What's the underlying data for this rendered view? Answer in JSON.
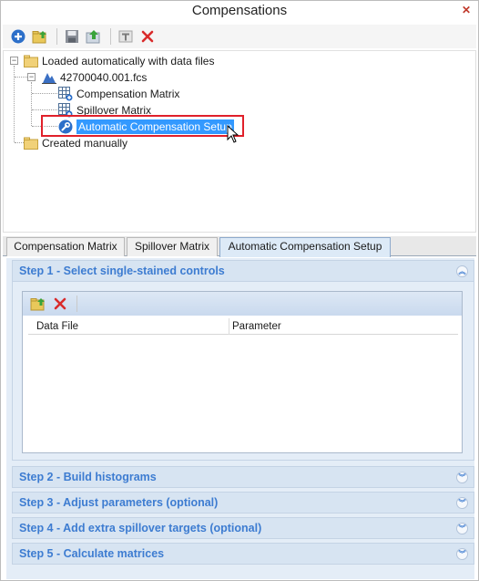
{
  "window": {
    "title": "Compensations"
  },
  "toolbar": {
    "icons": [
      "add-icon",
      "import-folder-icon",
      "save-icon",
      "export-icon",
      "rename-icon",
      "delete-icon"
    ],
    "delete_color": "#d92b2b"
  },
  "tree": {
    "root1": "Loaded automatically with data files",
    "file": "42700040.001.fcs",
    "child1": "Compensation Matrix",
    "child2": "Spillover Matrix",
    "child3": "Automatic Compensation Setup",
    "root2": "Created manually"
  },
  "tabs": [
    {
      "label": "Compensation Matrix"
    },
    {
      "label": "Spillover Matrix"
    },
    {
      "label": "Automatic Compensation Setup"
    }
  ],
  "steps": {
    "s1": "Step 1 - Select single-stained controls",
    "s2": "Step 2 - Build histograms",
    "s3": "Step 3 - Adjust parameters (optional)",
    "s4": "Step 4 - Add extra spillover targets (optional)",
    "s5": "Step 5 - Calculate matrices"
  },
  "grid": {
    "col1": "Data File",
    "col2": "Parameter"
  },
  "colors": {
    "accent": "#3d7cd1",
    "selection": "#3399ff",
    "highlight": "#e0202a"
  }
}
